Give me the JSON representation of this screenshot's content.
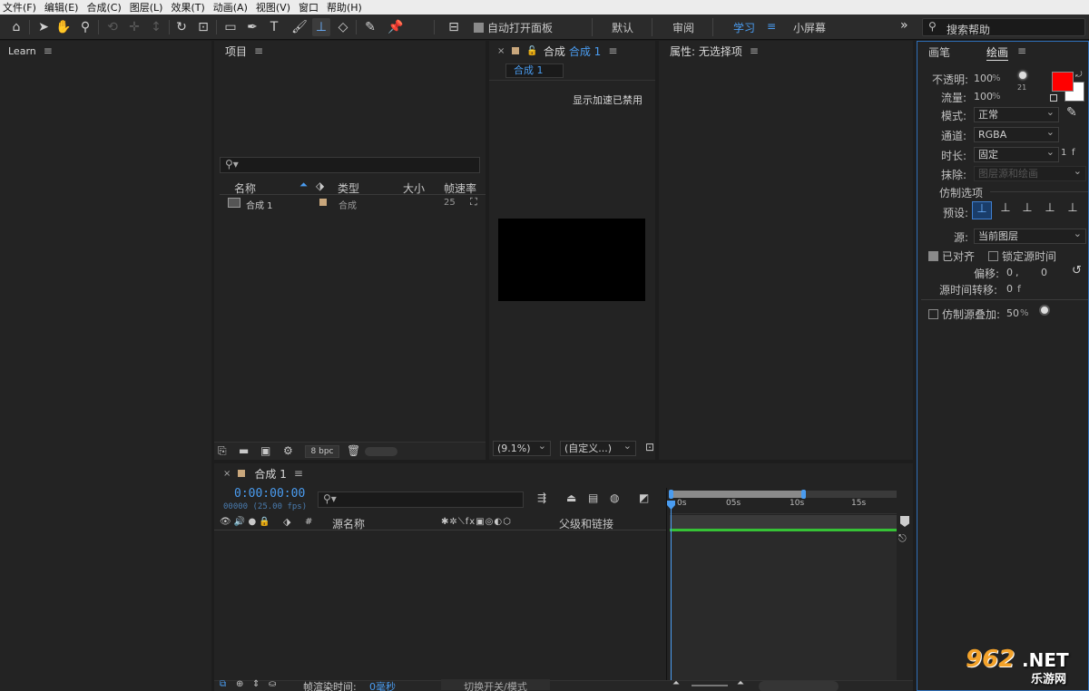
{
  "menubar": [
    "文件(F)",
    "编辑(E)",
    "合成(C)",
    "图层(L)",
    "效果(T)",
    "动画(A)",
    "视图(V)",
    "窗口",
    "帮助(H)"
  ],
  "toolbar": {
    "auto_open": "自动打开面板",
    "workspaces": [
      "默认",
      "审阅",
      "学习",
      "小屏幕"
    ],
    "active_workspace": "学习",
    "more": "»",
    "search_placeholder": "搜索帮助"
  },
  "learn": {
    "title": "Learn"
  },
  "project": {
    "title": "项目",
    "columns": {
      "name": "名称",
      "type": "类型",
      "size": "大小",
      "fps": "帧速率"
    },
    "items": [
      {
        "name": "合成 1",
        "type": "合成",
        "fps": "25"
      }
    ],
    "bpc": "8 bpc"
  },
  "composition": {
    "tab_prefix": "合成",
    "tab_name": "合成 1",
    "subtab": "合成 1",
    "notice": "显示加速已禁用",
    "zoom": "(9.1%)",
    "resolution": "(自定义...)"
  },
  "properties": {
    "title": "属性: 无选择项"
  },
  "paint": {
    "tabs": [
      "画笔",
      "绘画"
    ],
    "active_tab": "绘画",
    "opacity_label": "不透明:",
    "opacity_value": "100",
    "opacity_unit": "%",
    "flow_label": "流量:",
    "flow_value": "100",
    "flow_unit": "%",
    "brush_size": "21",
    "mode_label": "模式:",
    "mode_value": "正常",
    "channel_label": "通道:",
    "channel_value": "RGBA",
    "duration_label": "时长:",
    "duration_value": "固定",
    "duration_frames": "1",
    "duration_unit": "f",
    "erase_label": "抹除:",
    "erase_value": "图层源和绘画",
    "clone_options": "仿制选项",
    "preset_label": "预设:",
    "source_label": "源:",
    "source_value": "当前图层",
    "aligned_label": "已对齐",
    "lock_time_label": "锁定源时间",
    "offset_label": "偏移:",
    "offset_x": "0",
    "offset_sep": ",",
    "offset_y": "0",
    "time_shift_label": "源时间转移:",
    "time_shift_value": "0",
    "time_shift_unit": "f",
    "overlay_label": "仿制源叠加:",
    "overlay_value": "50",
    "overlay_unit": "%",
    "fg_color": "#ff0000",
    "bg_color": "#ffffff"
  },
  "timeline": {
    "tab": "合成 1",
    "timecode": "0:00:00:00",
    "frames": "00000 (25.00 fps)",
    "col_source": "源名称",
    "col_parent": "父级和链接",
    "ruler": [
      "0s",
      "05s",
      "10s",
      "15s"
    ],
    "render_label": "帧渲染时间:",
    "render_value": "0毫秒",
    "toggle": "切换开关/模式"
  },
  "watermark": {
    "brand": "962",
    "tld": ".NET",
    "sub": "乐游网"
  },
  "colors": {
    "accent": "#4a9cf0",
    "work_area_bar": "#36c236"
  }
}
